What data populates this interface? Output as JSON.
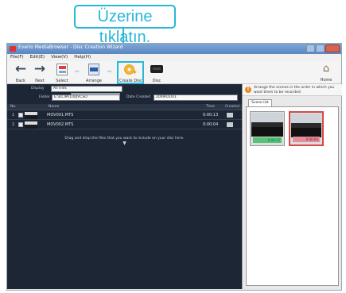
{
  "callout": {
    "text": "Üzerine tıklatın."
  },
  "window": {
    "title": "Everio MediaBrowser - Disc Creation Wizard",
    "menus": [
      "File(F)",
      "Edit(E)",
      "View(V)",
      "Help(H)"
    ]
  },
  "toolbar": {
    "back_label": "Back",
    "next_label": "Next",
    "select_label": "Select",
    "arrange_label": "Arrange",
    "create_label": "Create Disc",
    "disc_label": "Disc",
    "home_label": "Home",
    "icons": {
      "back": "arrow-left-icon",
      "next": "arrow-right-icon",
      "select": "select-icon",
      "arrange": "arrange-icon",
      "create": "create-disc-icon",
      "disc": "dvd-drive-icon",
      "home": "home-icon"
    },
    "highlight_color": "#29b6d8"
  },
  "filter": {
    "display_label": "Display",
    "display_value": "All Files",
    "folder_label": "Folder",
    "folder_value": "E:\\DCIM\\100JVCSO",
    "date_label": "Date Created",
    "date_value": "2009/01/01"
  },
  "table": {
    "columns": [
      "No.",
      "Name",
      "Time",
      "Created"
    ],
    "rows": [
      {
        "num": "1",
        "name": "MOV001.MTS",
        "duration": "0:00:13"
      },
      {
        "num": "2",
        "name": "MOV002.MTS",
        "duration": "0:00:04"
      }
    ],
    "info": "Drag and drop the files that you want to include on your disc here."
  },
  "right_panel": {
    "hint": "Arrange the scenes in the order in which you want them to be recorded.",
    "tab_label": "Scene list",
    "cards": [
      {
        "caption": "0:00:13",
        "selected": false
      },
      {
        "caption": "0:00:04",
        "selected": true
      }
    ]
  }
}
